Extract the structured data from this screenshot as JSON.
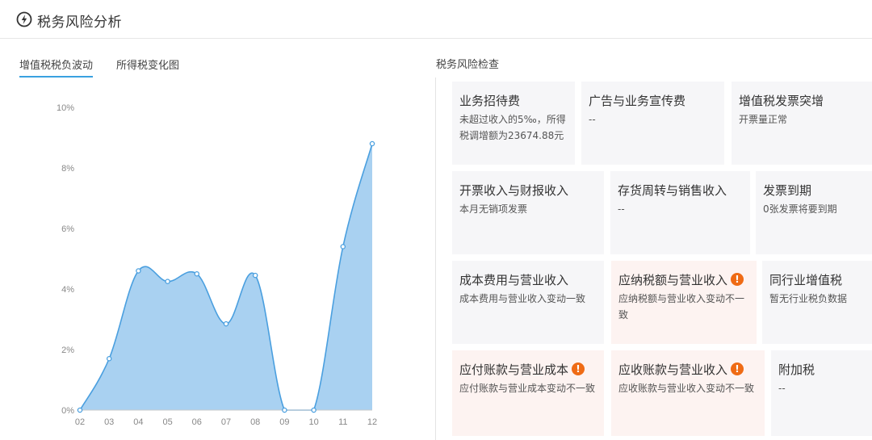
{
  "header": {
    "title": "税务风险分析",
    "icon": "lightning-circle-icon"
  },
  "tabs": [
    {
      "label": "增值税税负波动",
      "active": true
    },
    {
      "label": "所得税变化图",
      "active": false
    }
  ],
  "risk_section": {
    "title": "税务风险检查"
  },
  "cards": [
    {
      "title": "业务招待费",
      "desc": "未超过收入的5‰，所得税调增额为23674.88元",
      "warning": false
    },
    {
      "title": "广告与业务宣传费",
      "desc": "--",
      "warning": false
    },
    {
      "title": "增值税发票突增",
      "desc": "开票量正常",
      "warning": false
    },
    {
      "title": "开票收入与财报收入",
      "desc": "本月无销项发票",
      "warning": false
    },
    {
      "title": "存货周转与销售收入",
      "desc": "--",
      "warning": false
    },
    {
      "title": "发票到期",
      "desc": "0张发票将要到期",
      "warning": false
    },
    {
      "title": "成本费用与营业收入",
      "desc": "成本费用与营业收入变动一致",
      "warning": false
    },
    {
      "title": "应纳税额与营业收入",
      "desc": "应纳税额与营业收入变动不一致",
      "warning": true
    },
    {
      "title": "同行业增值税",
      "desc": "暂无行业税负数据",
      "warning": false
    },
    {
      "title": "应付账款与营业成本",
      "desc": "应付账款与营业成本变动不一致",
      "warning": true
    },
    {
      "title": "应收账款与营业收入",
      "desc": "应收账款与营业收入变动不一致",
      "warning": true
    },
    {
      "title": "附加税",
      "desc": "--",
      "warning": false
    }
  ],
  "colors": {
    "accent": "#3aa1e0",
    "area_fill": "#a9d1f1",
    "line": "#4a9fdf",
    "warning": "#ef6b15",
    "alert_card_bg": "#fdf3f1",
    "card_bg": "#f6f6f8"
  },
  "chart_data": {
    "type": "area",
    "categories": [
      "02",
      "03",
      "04",
      "05",
      "06",
      "07",
      "08",
      "09",
      "10",
      "11",
      "12"
    ],
    "series": [
      {
        "values": [
          0,
          1.7,
          4.6,
          4.25,
          4.5,
          2.85,
          4.45,
          0,
          0,
          5.4,
          8.8
        ]
      }
    ],
    "ylim": [
      0,
      10
    ],
    "yticks": [
      "0%",
      "2%",
      "4%",
      "6%",
      "8%",
      "10%"
    ],
    "grid": false
  }
}
